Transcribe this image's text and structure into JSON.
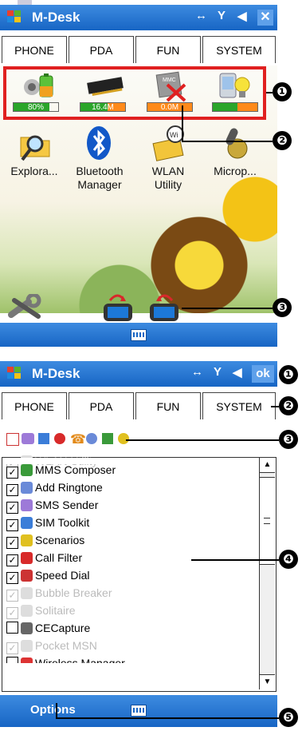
{
  "top": {
    "title": "M-Desk",
    "tabs": [
      "PHONE",
      "PDA",
      "FUN",
      "SYSTEM"
    ],
    "meters": [
      {
        "label": "80%",
        "level": 0.8,
        "color": "#2aa52a"
      },
      {
        "label": "16.4M",
        "level": 0.6,
        "color": "#2aa52a"
      },
      {
        "label": "0.0M",
        "level": 1.0,
        "color": "#ff8a1a"
      },
      {
        "label": "",
        "level": 0.55,
        "color": "#2aa52a"
      }
    ],
    "apps": [
      {
        "line1": "Explora...",
        "line2": ""
      },
      {
        "line1": "Bluetooth",
        "line2": "Manager"
      },
      {
        "line1": "WLAN",
        "line2": "Utility"
      },
      {
        "line1": "Microp...",
        "line2": ""
      }
    ]
  },
  "bottom": {
    "title": "M-Desk",
    "ok_label": "ok",
    "tabs": [
      "PHONE",
      "PDA",
      "FUN",
      "SYSTEM"
    ],
    "list": [
      {
        "label": "WLAN Utility",
        "checked": true,
        "disabled": true,
        "partial": true
      },
      {
        "label": "MMS Composer",
        "checked": true,
        "disabled": false
      },
      {
        "label": "Add Ringtone",
        "checked": true,
        "disabled": false
      },
      {
        "label": "SMS Sender",
        "checked": true,
        "disabled": false
      },
      {
        "label": "SIM Toolkit",
        "checked": true,
        "disabled": false
      },
      {
        "label": "Scenarios",
        "checked": true,
        "disabled": false
      },
      {
        "label": "Call Filter",
        "checked": true,
        "disabled": false
      },
      {
        "label": "Speed Dial",
        "checked": true,
        "disabled": false
      },
      {
        "label": "Bubble Breaker",
        "checked": true,
        "disabled": true
      },
      {
        "label": "Solitaire",
        "checked": true,
        "disabled": true
      },
      {
        "label": "CECapture",
        "checked": false,
        "disabled": false
      },
      {
        "label": "Pocket MSN",
        "checked": true,
        "disabled": true
      },
      {
        "label": "Wireless Manager",
        "checked": false,
        "disabled": false,
        "partial": true
      }
    ],
    "options_label": "Options"
  },
  "callouts": [
    "❶",
    "❷",
    "❸",
    "❶",
    "❷",
    "❸",
    "❹",
    "❺"
  ],
  "colors": {
    "accent": "#1765c4",
    "highlight": "#e02020",
    "meter_orange": "#ff8a1a",
    "meter_green": "#2aa52a"
  }
}
